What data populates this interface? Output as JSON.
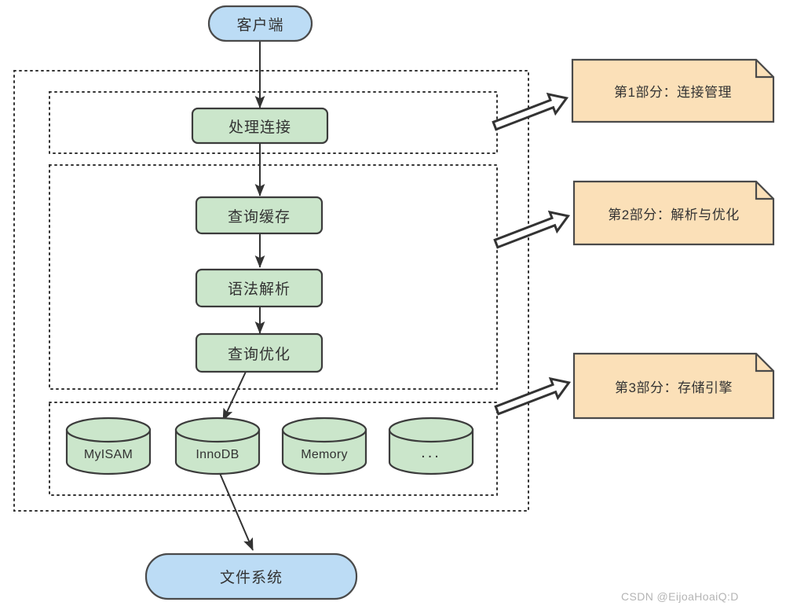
{
  "diagram": {
    "title_text_present": false,
    "colors": {
      "blue_fill": "#bcdcf5",
      "blue_stroke": "#4a4a4a",
      "green_fill": "#cbe6cb",
      "green_stroke": "#3c3c3c",
      "note_fill": "#fbe0b8",
      "note_stroke": "#4a4a4a",
      "dotted_stroke": "#333333",
      "arrow_stroke": "#333333",
      "text": "#333333",
      "watermark": "#b4b4b4"
    },
    "terminals": [
      {
        "id": "client",
        "label": "客户端",
        "shape": "rounded-stadium",
        "fill": "blue"
      },
      {
        "id": "filesystem",
        "label": "文件系统",
        "shape": "rounded-stadium",
        "fill": "blue"
      }
    ],
    "processes": [
      {
        "id": "handle-connection",
        "label": "处理连接",
        "shape": "rounded-rect",
        "fill": "green"
      },
      {
        "id": "query-cache",
        "label": "查询缓存",
        "shape": "rounded-rect",
        "fill": "green"
      },
      {
        "id": "syntax-parse",
        "label": "语法解析",
        "shape": "rounded-rect",
        "fill": "green"
      },
      {
        "id": "query-optimize",
        "label": "查询优化",
        "shape": "rounded-rect",
        "fill": "green"
      }
    ],
    "storage_engines": [
      {
        "id": "myisam",
        "label": "MyISAM",
        "shape": "cylinder",
        "fill": "green"
      },
      {
        "id": "innodb",
        "label": "InnoDB",
        "shape": "cylinder",
        "fill": "green"
      },
      {
        "id": "memory",
        "label": "Memory",
        "shape": "cylinder",
        "fill": "green"
      },
      {
        "id": "others",
        "label": "...",
        "shape": "cylinder",
        "fill": "green"
      }
    ],
    "notes": [
      {
        "id": "note-1",
        "label": "第1部分：连接管理",
        "shape": "folded-note",
        "fill": "note"
      },
      {
        "id": "note-2",
        "label": "第2部分：解析与优化",
        "shape": "folded-note",
        "fill": "note"
      },
      {
        "id": "note-3",
        "label": "第3部分：存储引擎",
        "shape": "folded-note",
        "fill": "note"
      }
    ],
    "groups": [
      {
        "id": "outer-group",
        "style": "dotted",
        "label": ""
      },
      {
        "id": "group-connection",
        "style": "dotted",
        "label": ""
      },
      {
        "id": "group-parse-optimize",
        "style": "dotted",
        "label": ""
      },
      {
        "id": "group-storage",
        "style": "dotted",
        "label": ""
      }
    ],
    "flow_arrows": [
      {
        "from": "client",
        "to": "handle-connection"
      },
      {
        "from": "handle-connection",
        "to": "query-cache"
      },
      {
        "from": "query-cache",
        "to": "syntax-parse"
      },
      {
        "from": "syntax-parse",
        "to": "query-optimize"
      },
      {
        "from": "query-optimize",
        "to": "innodb"
      },
      {
        "from": "innodb",
        "to": "filesystem"
      }
    ],
    "callout_arrows": [
      {
        "from": "group-connection",
        "to": "note-1",
        "style": "block-arrow"
      },
      {
        "from": "group-parse-optimize",
        "to": "note-2",
        "style": "block-arrow"
      },
      {
        "from": "group-storage",
        "to": "note-3",
        "style": "block-arrow"
      }
    ],
    "watermark": "CSDN @EijoaHoaiQ:D"
  }
}
